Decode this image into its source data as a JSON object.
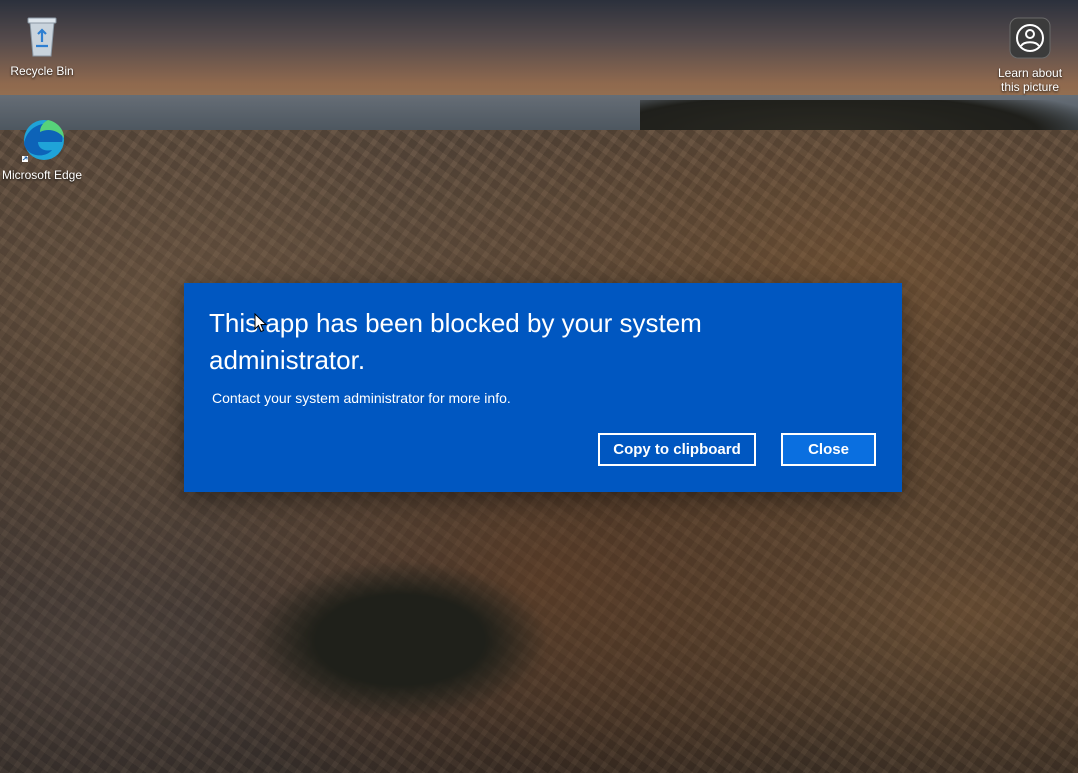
{
  "desktop": {
    "icons": [
      {
        "label": "Recycle Bin",
        "icon": "recycle-bin-icon"
      },
      {
        "label": "Microsoft Edge",
        "icon": "edge-icon"
      },
      {
        "label": "Learn about this picture",
        "icon": "camera-icon"
      }
    ]
  },
  "dialog": {
    "title": "This app has been blocked by your system administrator.",
    "message": "Contact your system administrator for more info.",
    "copy_label": "Copy to clipboard",
    "close_label": "Close"
  },
  "colors": {
    "dialog_background": "#0057c1",
    "close_button_background": "#0a6fe0",
    "text": "#ffffff"
  }
}
